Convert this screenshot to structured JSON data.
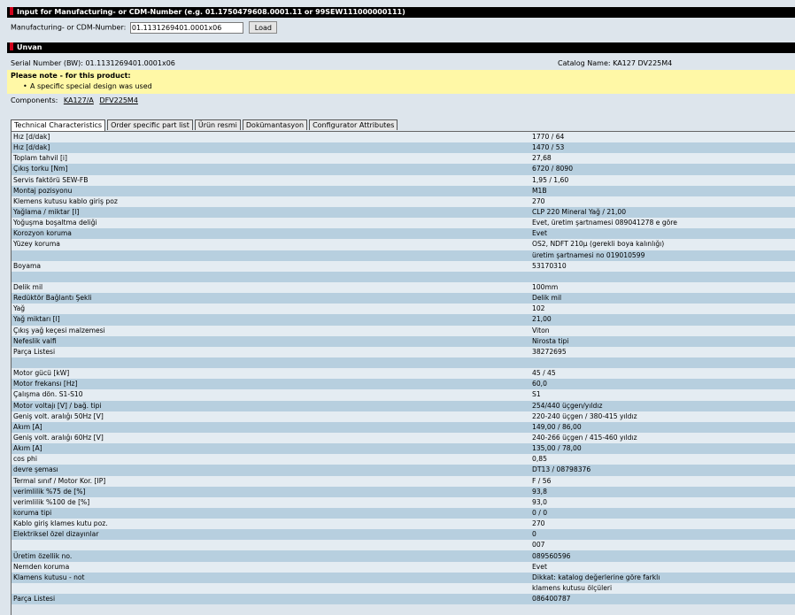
{
  "input_section": {
    "header": "Input for Manufacturing- or CDM-Number (e.g. 01.1750479608.0001.11 or 99SEW111000000111)",
    "label": "Manufacturing- or CDM-Number:",
    "value": "01.1131269401.0001x06",
    "load_label": "Load"
  },
  "unit_section": {
    "header": "Unvan",
    "serial": "Serial Number (BW): 01.1131269401.0001x06",
    "catalog": "Catalog Name: KA127 DV225M4"
  },
  "note": {
    "title": "Please note - for this product:",
    "items": [
      "A specific special design was used"
    ]
  },
  "components": {
    "label": "Components:",
    "links": [
      "KA127/A",
      "DFV225M4"
    ]
  },
  "tabs": [
    {
      "label": "Technical Characteristics",
      "active": true
    },
    {
      "label": "Order specific part list",
      "active": false
    },
    {
      "label": "Ürün resmi",
      "active": false
    },
    {
      "label": "Dokümantasyon",
      "active": false
    },
    {
      "label": "Configurator Attributes",
      "active": false
    }
  ],
  "rows": [
    [
      "Hız [d/dak]",
      "1770 / 64"
    ],
    [
      "Hız [d/dak]",
      "1470 / 53"
    ],
    [
      "Toplam tahvil [i]",
      "27,68"
    ],
    [
      "Çıkış torku [Nm]",
      "6720 / 8090"
    ],
    [
      "Servis faktörü SEW-FB",
      "1,95 / 1,60"
    ],
    [
      "Montaj pozisyonu",
      "M1B"
    ],
    [
      "Klemens kutusu kablo giriş poz",
      "270"
    ],
    [
      "Yağlama / miktar [l]",
      "CLP 220 Mineral Yağ / 21,00"
    ],
    [
      "Yoğuşma boşaltma deliği",
      "Evet, üretim şartnamesi 089041278 e göre"
    ],
    [
      "Korozyon koruma",
      "Evet"
    ],
    [
      "Yüzey koruma",
      "OS2, NDFT 210µ (gerekli boya kalınlığı)"
    ],
    [
      "",
      "üretim şartnamesi no 019010599"
    ],
    [
      "Boyama",
      "53170310"
    ],
    [
      "",
      ""
    ],
    [
      "Delik mil",
      "100mm"
    ],
    [
      "Redüktör Bağlantı Şekli",
      "Delik mil"
    ],
    [
      "Yağ",
      "102"
    ],
    [
      "Yağ miktarı [l]",
      "21,00"
    ],
    [
      "Çıkış yağ keçesi malzemesi",
      "Viton"
    ],
    [
      "Nefeslik valfi",
      "Nirosta tipi"
    ],
    [
      "Parça Listesi",
      "38272695"
    ],
    [
      "",
      ""
    ],
    [
      "Motor gücü [kW]",
      "45 / 45"
    ],
    [
      "Motor frekansı [Hz]",
      "60,0"
    ],
    [
      "Çalışma dön. S1-S10",
      "S1"
    ],
    [
      "Motor voltajı [V] / bağ. tipi",
      "254/440 üçgen/yıldız"
    ],
    [
      "Geniş volt. aralığı 50Hz [V]",
      "220-240 üçgen / 380-415 yıldız"
    ],
    [
      "Akım [A]",
      "149,00 / 86,00"
    ],
    [
      "Geniş volt. aralığı 60Hz [V]",
      "240-266 üçgen / 415-460 yıldız"
    ],
    [
      "Akım [A]",
      "135,00 / 78,00"
    ],
    [
      "cos phi",
      "0,85"
    ],
    [
      "devre şeması",
      "DT13 / 08798376"
    ],
    [
      "Termal sınıf / Motor Kor. [IP]",
      "F / 56"
    ],
    [
      "verimlilik %75 de [%]",
      "93,8"
    ],
    [
      "verimlilik %100 de [%]",
      "93,0"
    ],
    [
      "koruma tipi",
      "0 / 0"
    ],
    [
      "Kablo giriş klames kutu poz.",
      "270"
    ],
    [
      "Elektriksel özel dizayınlar",
      "0"
    ],
    [
      "",
      "007"
    ],
    [
      "Üretim özellik no.",
      "089560596"
    ],
    [
      "Nemden koruma",
      "Evet"
    ],
    [
      "Klamens kutusu - not",
      "Dikkat: katalog değerlerine göre farklı"
    ],
    [
      "",
      "klamens kutusu ölçüleri"
    ],
    [
      "Parça Listesi",
      "086400787"
    ]
  ],
  "colors": {
    "header_bg": "#000000",
    "header_mark": "#d0021b",
    "note_bg": "#fff8a6",
    "row_light": "#e4ecf2",
    "row_dark": "#b7cfdf",
    "page_bg": "#dde5ec"
  }
}
